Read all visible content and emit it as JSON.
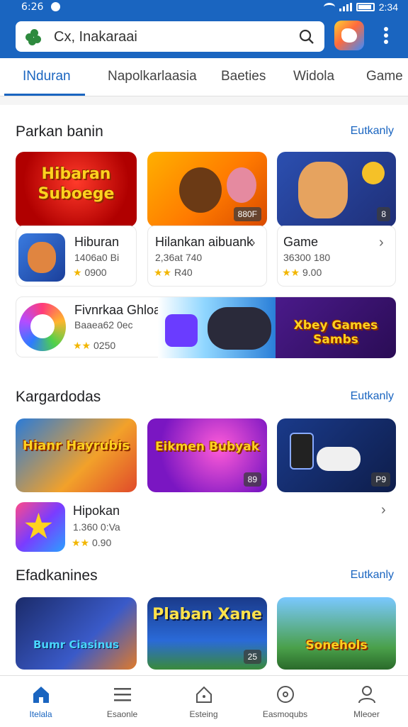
{
  "status": {
    "time": "6:26",
    "clock_right": "2:34"
  },
  "search": {
    "text": "Cx, Inakaraai"
  },
  "tabs": [
    {
      "label": "INduran"
    },
    {
      "label": "Napolkarlaasia"
    },
    {
      "label": "Baeties"
    },
    {
      "label": "Widola"
    },
    {
      "label": "Game"
    }
  ],
  "sections": [
    {
      "title": "Parkan banin",
      "link": "Eutkanly",
      "banners": [
        {
          "art_text": "Hibaran Suboege",
          "chip": ""
        },
        {
          "art_text": "",
          "chip": "880F"
        },
        {
          "art_text": "",
          "chip": "8"
        }
      ],
      "apps": [
        {
          "title": "Hiburan",
          "meta": "1406a0 Bi",
          "rating": "0900"
        },
        {
          "title": "Hilankan aibuank",
          "meta": "2,36at 740",
          "rating": "R40"
        },
        {
          "title": "Game",
          "meta": "36300 180",
          "rating": "9.00"
        }
      ],
      "promo": {
        "title": "Fivnrkaa Ghloanisn",
        "meta": "Baaea62 0ec",
        "rating": "0250",
        "art_right": "Xbey Games Sambs",
        "art_left_a": "Games",
        "art_left_b": "Sambs"
      }
    },
    {
      "title": "Kargardodas",
      "link": "Eutkanly",
      "banners": [
        {
          "art_text": "Hianr Hayrubis",
          "chip": ""
        },
        {
          "art_text": "Eikmen Bubyak",
          "chip": "89"
        },
        {
          "art_text": "",
          "chip": "P9"
        }
      ],
      "apps": [
        {
          "title": "Hipokan",
          "meta": "1.360 0:Va",
          "rating": "0.90"
        }
      ]
    },
    {
      "title": "Efadkanines",
      "link": "Eutkanly",
      "banners": [
        {
          "art_text": "Bumr Ciasinus",
          "chip": ""
        },
        {
          "art_text": "Plaban Xane",
          "chip": "25"
        },
        {
          "art_text": "Sonehols",
          "chip": ""
        }
      ]
    }
  ],
  "bottom_nav": [
    {
      "label": "Itelala",
      "icon": "home-icon"
    },
    {
      "label": "Esaonle",
      "icon": "list-icon"
    },
    {
      "label": "Esteing",
      "icon": "house-outline-icon"
    },
    {
      "label": "Easmoqubs",
      "icon": "disc-icon"
    },
    {
      "label": "Mleoer",
      "icon": "person-icon"
    }
  ],
  "colors": {
    "accent": "#1a65c0",
    "star": "#f2b600"
  }
}
